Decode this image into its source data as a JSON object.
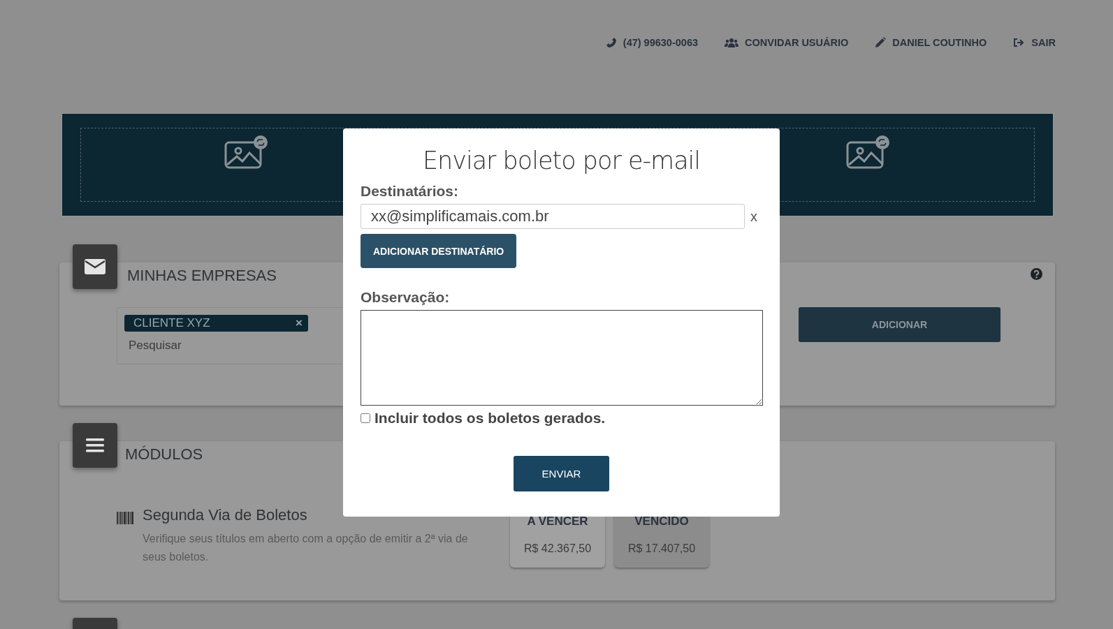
{
  "top_nav": [
    {
      "kind": "phone",
      "label": "(47) 99630-0063"
    },
    {
      "kind": "users",
      "label": "CONVIDAR USUÁRIO"
    },
    {
      "kind": "pencil",
      "label": "DANIEL COUTINHO"
    },
    {
      "kind": "logout",
      "label": "SAIR"
    }
  ],
  "companies": {
    "title": "MINHAS EMPRESAS",
    "chips": [
      {
        "label": "CLIENTE XYZ",
        "remove": "×"
      }
    ],
    "search": {
      "placeholder": "Pesquisar"
    },
    "add_button": "ADICIONAR"
  },
  "modules": {
    "title": "MÓDULOS",
    "items": [
      {
        "title": "Segunda Via de Boletos",
        "description": "Verifique seus títulos em aberto com a opção de emitir a 2ª via de seus boletos.",
        "statuses": [
          {
            "label": "A VENCER",
            "amount": "R$ 42.367,50",
            "selected": false
          },
          {
            "label": "VENCIDO",
            "amount": "R$ 17.407,50",
            "selected": true
          }
        ]
      }
    ]
  },
  "modal": {
    "title": "Enviar boleto por e-mail",
    "recipients_label": "Destinatários:",
    "recipients": [
      {
        "value": "xx@simplificamais.com.br",
        "remove": "x"
      }
    ],
    "add_recipient_button": "ADICIONAR DESTINATÁRIO",
    "note_label": "Observação:",
    "include_all": {
      "label": "Incluir todos os boletos gerados.",
      "checked": false
    },
    "send_button": "ENVIAR"
  }
}
